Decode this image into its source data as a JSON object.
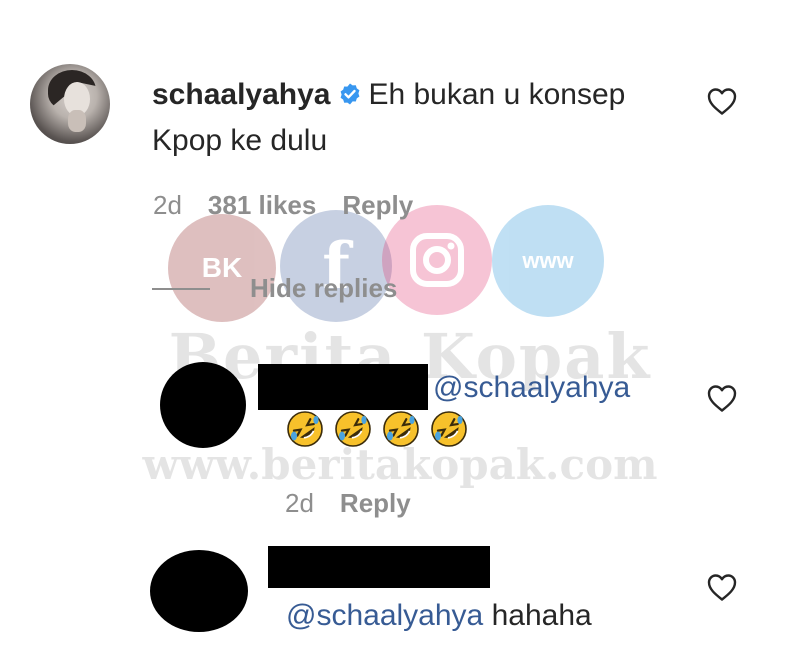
{
  "watermark": {
    "badge_text": "BK",
    "fb_glyph": "f",
    "www_text": "www",
    "brand": "Berita Kopak",
    "url": "www.beritakopak.com"
  },
  "main_comment": {
    "username": "schaalyahya",
    "verified_icon": "verified-badge-icon",
    "text": "Eh bukan u konsep Kpop ke dulu",
    "time": "2d",
    "likes": "381 likes",
    "reply_label": "Reply",
    "like_icon": "heart-icon"
  },
  "thread": {
    "hide_replies_label": "Hide replies"
  },
  "replies": [
    {
      "mention": "@schaalyahya",
      "emoji_icon": "rolling-on-floor-laughing-emoji",
      "emoji_count": 4,
      "time": "2d",
      "reply_label": "Reply",
      "like_icon": "heart-icon"
    },
    {
      "mention": "@schaalyahya",
      "text": "hahaha",
      "like_icon": "heart-icon"
    }
  ],
  "colors": {
    "mention": "#375b94",
    "verified": "#3897f0",
    "meta": "#8e8e8e",
    "text": "#262626"
  }
}
